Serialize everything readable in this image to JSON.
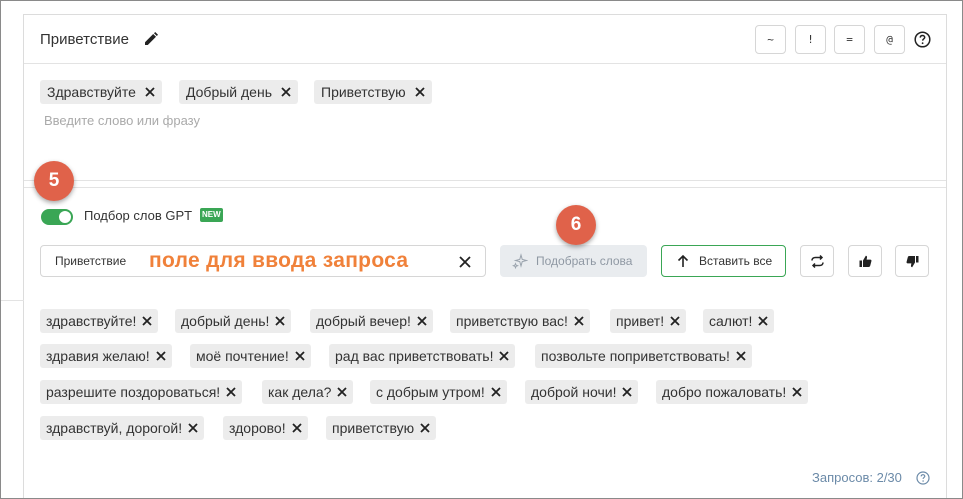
{
  "header": {
    "title": "Приветствие",
    "buttons": [
      "~",
      "!",
      "=",
      "@"
    ]
  },
  "keywords": {
    "chips": [
      "Здравствуйте",
      "Добрый день",
      "Приветствую"
    ],
    "placeholder": "Введите слово или фразу"
  },
  "annotations": {
    "step5": "5",
    "step6": "6",
    "query_hint": "поле для ввода запроса"
  },
  "gpt": {
    "toggle_label": "Подбор слов GPT",
    "toggle_on": true,
    "new_badge": "NEW",
    "query_value": "Приветствие",
    "pick_button": "Подобрать слова",
    "insert_all_button": "Вставить все",
    "suggestions": [
      "здравствуйте!",
      "добрый день!",
      "добрый вечер!",
      "приветствую вас!",
      "привет!",
      "салют!",
      "здравия желаю!",
      "моё почтение!",
      "рад вас приветствовать!",
      "позвольте поприветствовать!",
      "разрешите поздороваться!",
      "как дела?",
      "с добрым утром!",
      "доброй ночи!",
      "добро пожаловать!",
      "здравствуй, дорогой!",
      "здорово!",
      "приветствую"
    ]
  },
  "footer": {
    "requests": "Запросов: 2/30"
  },
  "colors": {
    "accent_green": "#3aa655",
    "badge_red": "#e0624a",
    "annotation_orange": "#f0813a",
    "chip_bg": "#ececec"
  },
  "icons": [
    "pencil-icon",
    "help-icon",
    "close-icon",
    "sparkle-icon",
    "arrow-up-icon",
    "refresh-icon",
    "thumbs-up-icon",
    "thumbs-down-icon"
  ]
}
